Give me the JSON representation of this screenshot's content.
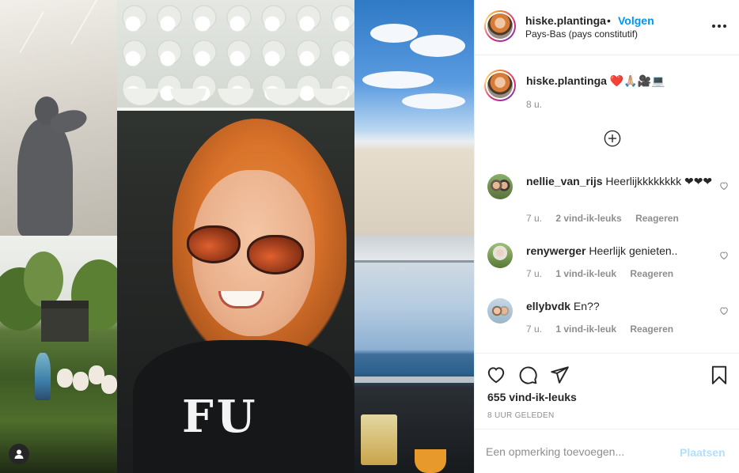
{
  "post": {
    "username": "hiske.plantinga",
    "separator": "•",
    "follow_label": "Volgen",
    "location": "Pays-Bas (pays constitutif)",
    "more_icon": "more-options-icon",
    "caption_emojis": "❤️🙏🏼🎥💻",
    "caption_time": "8 u.",
    "load_more_icon": "plus-circle-icon"
  },
  "comments": [
    {
      "username": "nellie_van_rijs",
      "text": "Heerlijkkkkkkkk ❤❤❤",
      "time": "7 u.",
      "likes": "2 vind-ik-leuks",
      "reply": "Reageren"
    },
    {
      "username": "renywerger",
      "text": "Heerlijk genieten..",
      "time": "7 u.",
      "likes": "1 vind-ik-leuk",
      "reply": "Reageren"
    },
    {
      "username": "ellybvdk",
      "text": "En??",
      "time": "7 u.",
      "likes": "1 vind-ik-leuk",
      "reply": "Reageren"
    }
  ],
  "actions": {
    "like_icon": "heart-icon",
    "comment_icon": "comment-icon",
    "share_icon": "share-icon",
    "save_icon": "bookmark-icon",
    "like_count": "655 vind-ik-leuks",
    "posted_ago": "8 UUR GELEDEN"
  },
  "add_comment": {
    "placeholder": "Een opmerking toevoegen...",
    "post_label": "Plaatsen"
  },
  "media": {
    "shirt_text": "FU",
    "tag_icon": "user-tag-icon"
  },
  "colors": {
    "accent": "#0095f6",
    "post_disabled": "#b2dffc",
    "muted": "#8e8e8e",
    "text": "#262626"
  }
}
